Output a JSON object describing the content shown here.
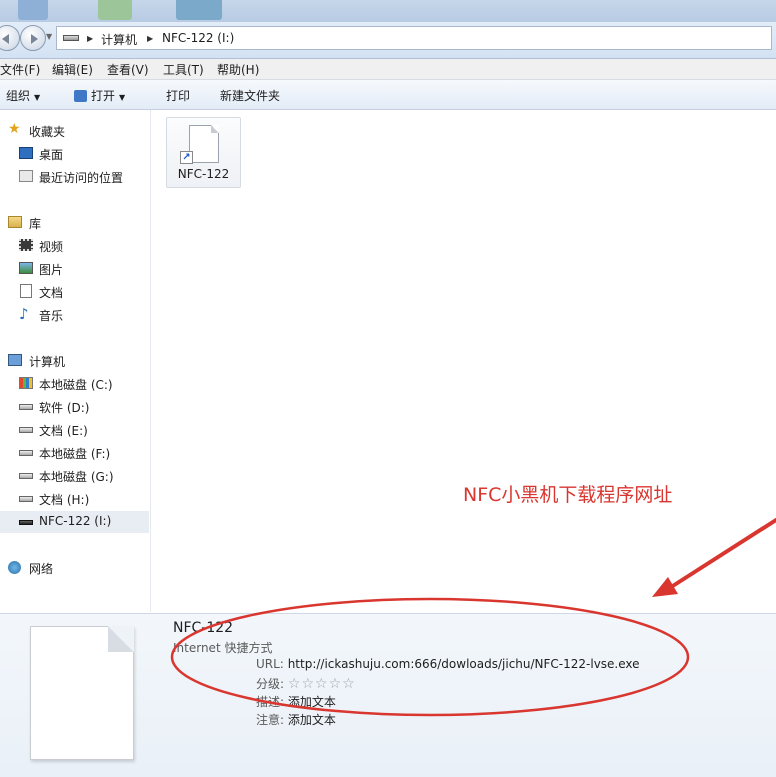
{
  "address": {
    "crumbs": [
      "计算机",
      "NFC-122 (I:)"
    ]
  },
  "menu": [
    "文件(F)",
    "编辑(E)",
    "查看(V)",
    "工具(T)",
    "帮助(H)"
  ],
  "toolbar": {
    "organize": "组织",
    "open": "打开",
    "print": "打印",
    "new_folder": "新建文件夹"
  },
  "nav": {
    "favorites": "收藏夹",
    "desktop": "桌面",
    "recent": "最近访问的位置",
    "libraries": "库",
    "videos": "视频",
    "pictures": "图片",
    "documents": "文档",
    "music": "音乐",
    "computer": "计算机",
    "drive_c": "本地磁盘 (C:)",
    "drive_d": "软件 (D:)",
    "drive_e": "文档 (E:)",
    "drive_f": "本地磁盘 (F:)",
    "drive_g": "本地磁盘 (G:)",
    "drive_h": "文档 (H:)",
    "drive_i": "NFC-122 (I:)",
    "network": "网络"
  },
  "files": [
    {
      "name": "NFC-122",
      "icon": "shortcut-file-icon"
    }
  ],
  "details": {
    "title": "NFC-122",
    "type": "Internet 快捷方式",
    "url_label": "URL:",
    "url": "http://ickashuju.com:666/dowloads/jichu/NFC-122-lvse.exe",
    "rating_label": "分级:",
    "rating": 0,
    "rating_max": 5,
    "desc_label": "描述:",
    "desc": "添加文本",
    "note_label": "注意:",
    "note": "添加文本"
  },
  "annotation": {
    "text": "NFC小黑机下载程序网址",
    "color": "#d9362f"
  },
  "colors": {
    "toolbar_bg": "#e3ecf7",
    "details_bg": "#eef3f8",
    "annotation": "#d9362f"
  }
}
